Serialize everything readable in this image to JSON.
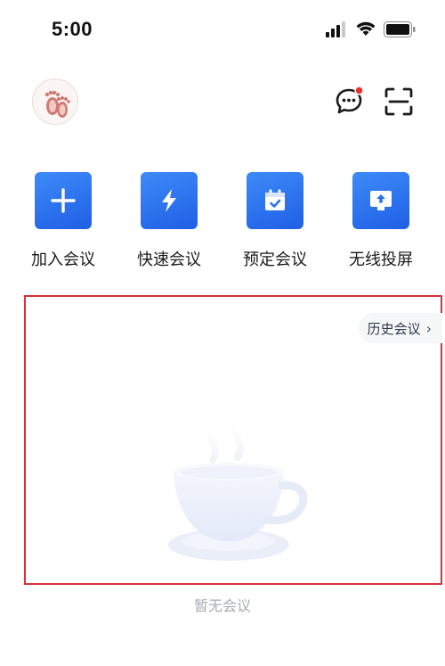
{
  "status_bar": {
    "time": "5:00"
  },
  "quick_actions": [
    {
      "label": "加入会议",
      "icon": "plus-icon"
    },
    {
      "label": "快速会议",
      "icon": "lightning-icon"
    },
    {
      "label": "预定会议",
      "icon": "calendar-icon"
    },
    {
      "label": "无线投屏",
      "icon": "screen-cast-icon"
    }
  ],
  "meetings": {
    "history_label": "历史会议",
    "empty_text": "暂无会议"
  },
  "colors": {
    "accent": "#2a6ff0",
    "notification_dot": "#e8322f",
    "highlight_border": "#d9313b"
  }
}
